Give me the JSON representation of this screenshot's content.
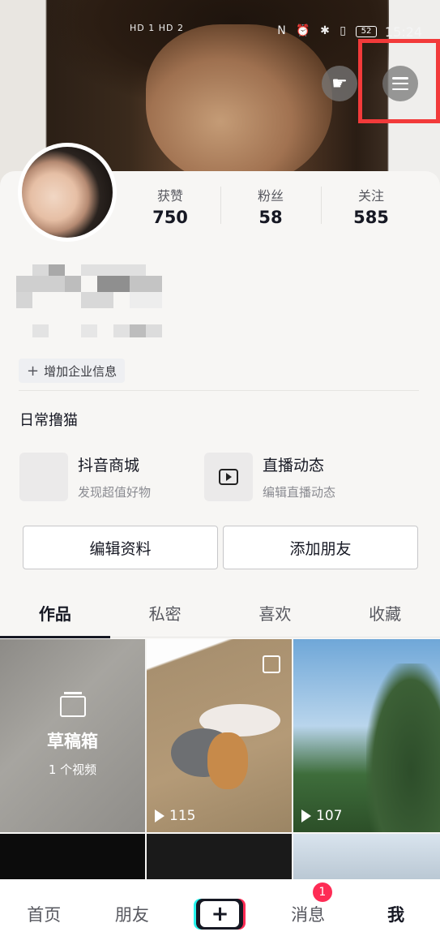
{
  "status_bar": {
    "time": "15:24",
    "battery": "52",
    "signal_left": "HD 1 HD 2"
  },
  "profile": {
    "stats": [
      {
        "label": "获赞",
        "value": "750"
      },
      {
        "label": "粉丝",
        "value": "58"
      },
      {
        "label": "关注",
        "value": "585"
      }
    ],
    "add_business_label": "增加企业信息",
    "bio": "日常撸猫"
  },
  "features": [
    {
      "title": "抖音商城",
      "subtitle": "发现超值好物",
      "icon": "shop-icon"
    },
    {
      "title": "直播动态",
      "subtitle": "编辑直播动态",
      "icon": "tv-icon"
    }
  ],
  "actions": {
    "edit_profile": "编辑资料",
    "add_friends": "添加朋友"
  },
  "tabs": [
    "作品",
    "私密",
    "喜欢",
    "收藏"
  ],
  "grid": {
    "drafts": {
      "title": "草稿箱",
      "subtitle": "1 个视频"
    },
    "views": [
      "115",
      "107"
    ]
  },
  "nav": {
    "home": "首页",
    "friends": "朋友",
    "create": "+",
    "messages": "消息",
    "messages_badge": "1",
    "me": "我"
  },
  "colors": {
    "highlight": "#f23a3a",
    "badge": "#fe2c55",
    "text": "#161823"
  }
}
